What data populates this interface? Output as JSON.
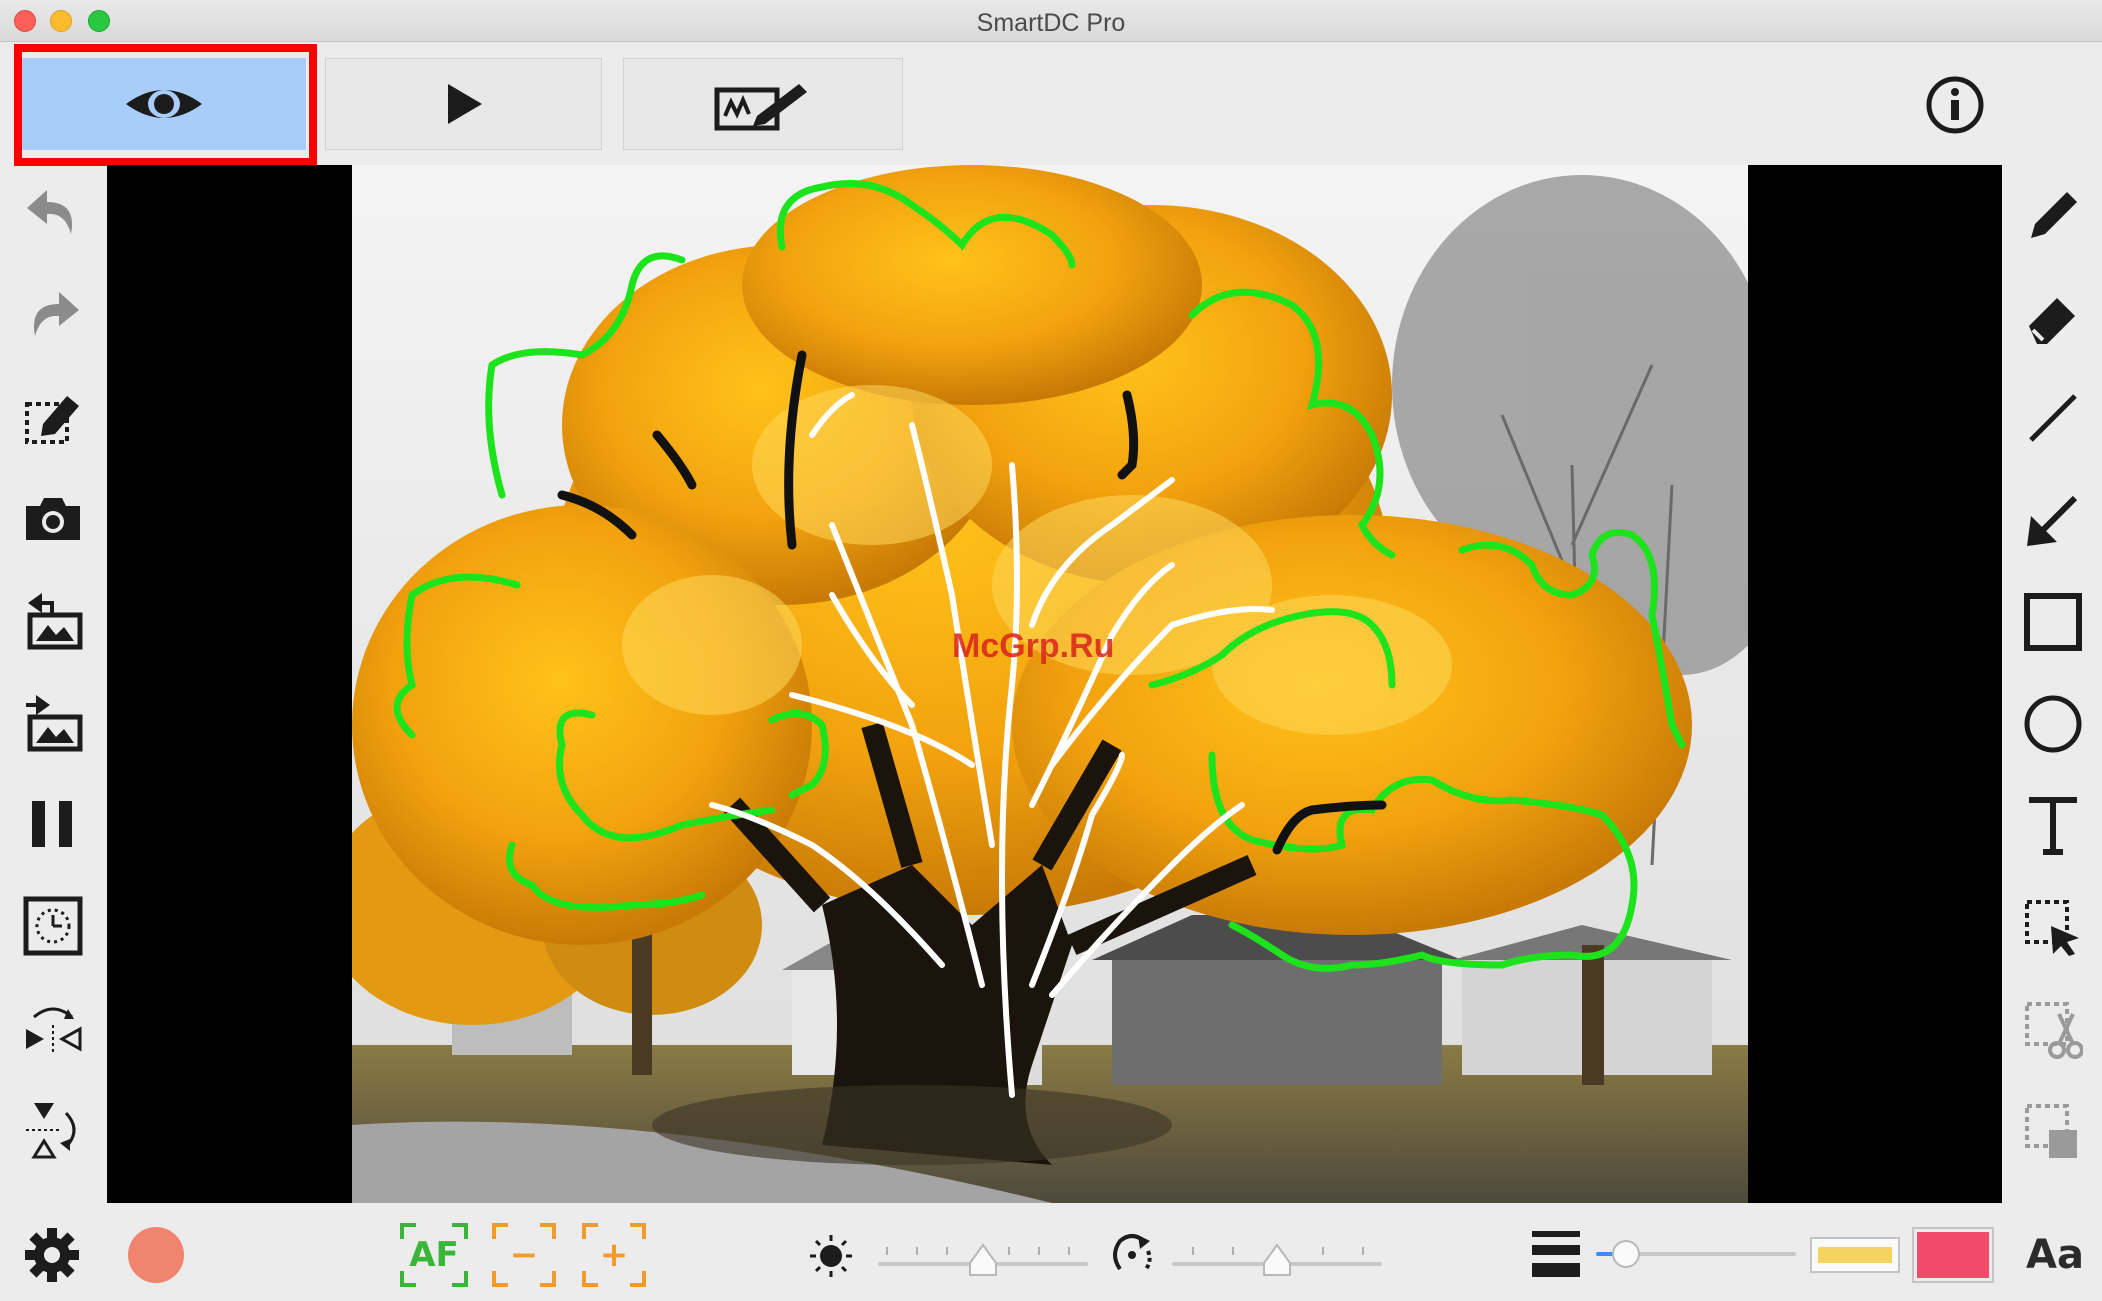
{
  "window": {
    "title": "SmartDC Pro"
  },
  "toolbar": {
    "tabs": [
      {
        "name": "preview",
        "icon": "eye-icon",
        "selected": true
      },
      {
        "name": "play",
        "icon": "play-icon",
        "selected": false
      },
      {
        "name": "annotate",
        "icon": "annotate-board-icon",
        "selected": false
      }
    ],
    "info_icon": "info-icon"
  },
  "left_tools": [
    "undo-icon",
    "redo-icon",
    "clear-annotations-icon",
    "camera-icon",
    "import-image-icon",
    "export-image-icon",
    "pause-icon",
    "timer-icon",
    "flip-horizontal-icon",
    "flip-vertical-icon"
  ],
  "right_tools": [
    "pen-icon",
    "eraser-icon",
    "line-icon",
    "arrow-icon",
    "rectangle-icon",
    "circle-icon",
    "text-icon",
    "select-icon",
    "cut-icon",
    "copy-icon"
  ],
  "viewer": {
    "watermark": "McGrp.Ru"
  },
  "bottom": {
    "settings_icon": "gear-icon",
    "record_color": "#f0846f",
    "autofocus_label": "AF",
    "zoom_out_label": "−",
    "zoom_in_label": "+",
    "brightness_icon": "sun-icon",
    "brightness_level": 0.5,
    "rotate_icon": "rotate-icon",
    "rotate_level": 0.5,
    "line_width_icon": "line-width-icon",
    "line_width_level": 0.15,
    "highlight_color": "#f4d35e",
    "pen_color": "#f24b6a",
    "font_label": "Aa"
  },
  "colors": {
    "accent_selected_tab": "#a8cdf8",
    "highlight_frame": "#ff0000",
    "drawn_outline": "#1de31d",
    "drawn_branches": "#ffffff"
  }
}
